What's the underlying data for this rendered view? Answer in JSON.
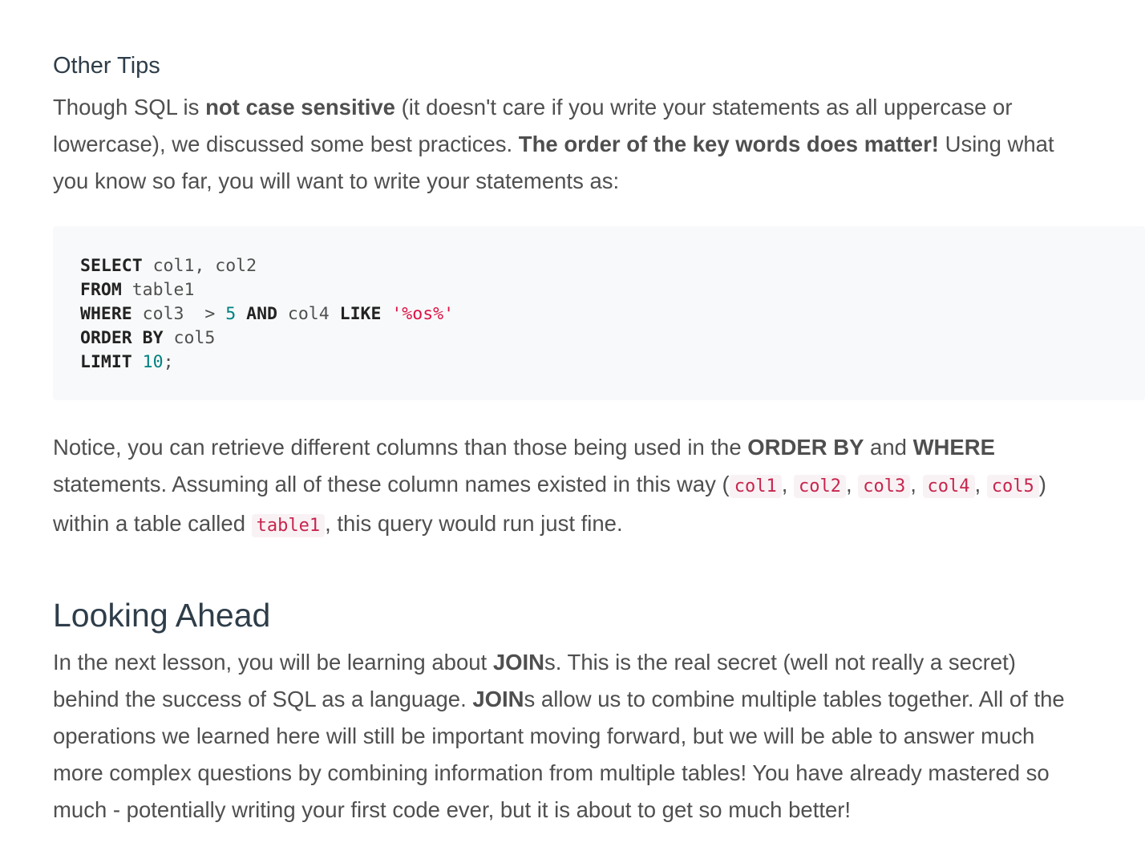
{
  "other_tips": {
    "heading": "Other Tips",
    "p1": {
      "a": "Though SQL is ",
      "b1": "not case sensitive",
      "c": " (it doesn't care if you write your statements as all uppercase or",
      "d": "lowercase), we discussed some best practices. ",
      "b2": "The order of the key words does matter!",
      "e": " Using what",
      "f": "you know so far, you will want to write your statements as:"
    },
    "code": {
      "l1_kw": "SELECT",
      "l1_rest": " col1, col2",
      "l2_kw": "FROM",
      "l2_rest": " table1",
      "l3_kw": "WHERE",
      "l3_a": " col3  > ",
      "l3_num": "5",
      "l3_kw2": " AND",
      "l3_b": " col4 ",
      "l3_kw3": "LIKE",
      "l3_str": " '%os%'",
      "l4_kw": "ORDER BY",
      "l4_rest": " col5",
      "l5_kw": "LIMIT",
      "l5_num": " 10",
      "l5_end": ";"
    },
    "p2": {
      "a": "Notice, you can retrieve different columns than those being used in the ",
      "b1": "ORDER BY",
      "c": " and ",
      "b2": "WHERE",
      "d": "statements. Assuming all of these column names existed in this way (",
      "codes": [
        "col1",
        "col2",
        "col3",
        "col4",
        "col5"
      ],
      "sep": ", ",
      "e": ")",
      "f": "within a table called ",
      "code_table": "table1",
      "g": ", this query would run just fine."
    }
  },
  "looking_ahead": {
    "heading": "Looking Ahead",
    "p": {
      "a": "In the next lesson, you will be learning about ",
      "b1": "JOIN",
      "c": "s. This is the real secret (well not really a secret)",
      "d": "behind the success of SQL as a language. ",
      "b2": "JOIN",
      "e": "s allow us to combine multiple tables together. All of the",
      "f": "operations we learned here will still be important moving forward, but we will be able to answer much",
      "g": "more complex questions by combining information from multiple tables! You have already mastered so",
      "h": "much - potentially writing your first code ever, but it is about to get so much better!"
    }
  }
}
